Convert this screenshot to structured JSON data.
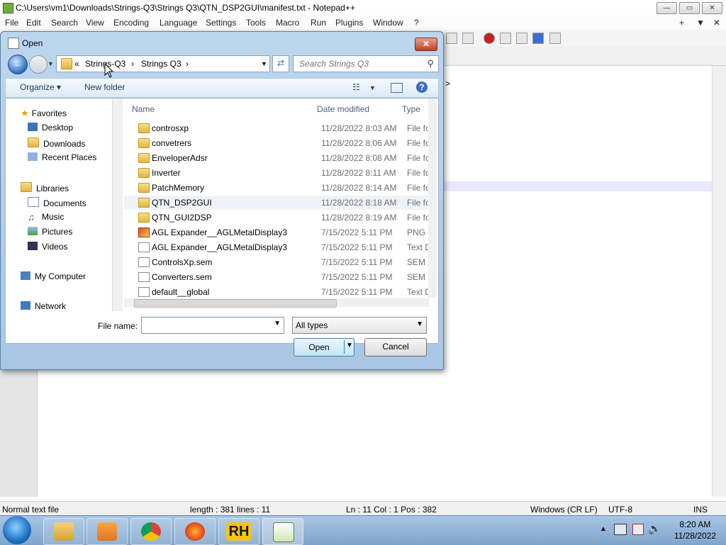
{
  "np": {
    "title": "C:\\Users\\vm1\\Downloads\\Strings-Q3\\Strings Q3\\QTN_DSP2GUI\\manifest.txt - Notepad++",
    "menu": [
      "File",
      "Edit",
      "Search",
      "View",
      "Encoding",
      "Language",
      "Settings",
      "Tools",
      "Macro",
      "Run",
      "Plugins",
      "Window",
      "?"
    ],
    "menu_right": [
      "+",
      "▼",
      "✕"
    ],
    "editor_char": ">",
    "status": {
      "type": "Normal text file",
      "length": "length : 381    lines : 11",
      "pos": "Ln : 11    Col : 1    Pos : 382",
      "eol": "Windows (CR LF)",
      "enc": "UTF-8",
      "mode": "INS"
    }
  },
  "dialog": {
    "title": "Open",
    "close": "✕",
    "breadcrumb": {
      "prefix": "«",
      "part1": "Strings-Q3",
      "sep": "›",
      "part2": "Strings Q3",
      "sep2": "›"
    },
    "search_placeholder": "Search Strings Q3",
    "organize": "Organize ▾",
    "new_folder": "New folder",
    "columns": {
      "name": "Name",
      "date": "Date modified",
      "type": "Type"
    },
    "nav": {
      "favorites": "Favorites",
      "desktop": "Desktop",
      "downloads": "Downloads",
      "recent": "Recent Places",
      "libraries": "Libraries",
      "documents": "Documents",
      "music": "Music",
      "pictures": "Pictures",
      "videos": "Videos",
      "computer": "My Computer",
      "network": "Network"
    },
    "files": [
      {
        "name": "controsxp",
        "date": "11/28/2022 8:03 AM",
        "type": "File folder",
        "icon": "folder"
      },
      {
        "name": "convetrers",
        "date": "11/28/2022 8:06 AM",
        "type": "File folder",
        "icon": "folder"
      },
      {
        "name": "EnveloperAdsr",
        "date": "11/28/2022 8:08 AM",
        "type": "File folder",
        "icon": "folder"
      },
      {
        "name": "Inverter",
        "date": "11/28/2022 8:11 AM",
        "type": "File folder",
        "icon": "folder"
      },
      {
        "name": "PatchMemory",
        "date": "11/28/2022 8:14 AM",
        "type": "File folder",
        "icon": "folder"
      },
      {
        "name": "QTN_DSP2GUI",
        "date": "11/28/2022 8:18 AM",
        "type": "File folder",
        "icon": "folder"
      },
      {
        "name": "QTN_GUI2DSP",
        "date": "11/28/2022 8:19 AM",
        "type": "File folder",
        "icon": "folder"
      },
      {
        "name": "AGL Expander__AGLMetalDisplay3",
        "date": "7/15/2022 5:11 PM",
        "type": "PNG image",
        "icon": "png"
      },
      {
        "name": "AGL Expander__AGLMetalDisplay3",
        "date": "7/15/2022 5:11 PM",
        "type": "Text Document",
        "icon": "file"
      },
      {
        "name": "ControlsXp.sem",
        "date": "7/15/2022 5:11 PM",
        "type": "SEM File",
        "icon": "file"
      },
      {
        "name": "Converters.sem",
        "date": "7/15/2022 5:11 PM",
        "type": "SEM File",
        "icon": "file"
      },
      {
        "name": "default__global",
        "date": "7/15/2022 5:11 PM",
        "type": "Text Document",
        "icon": "file"
      }
    ],
    "filename_label": "File name:",
    "filename_value": "",
    "filetype": "All types",
    "open_label": "Open",
    "cancel_label": "Cancel"
  },
  "taskbar": {
    "time": "8:20 AM",
    "date": "11/28/2022",
    "rh_label": "RH"
  },
  "colors": {
    "accent": "#3c7fb1",
    "dialog_frame": "#bcd6ee",
    "taskbar": "#a9c5e3",
    "close_red": "#c2412a"
  }
}
